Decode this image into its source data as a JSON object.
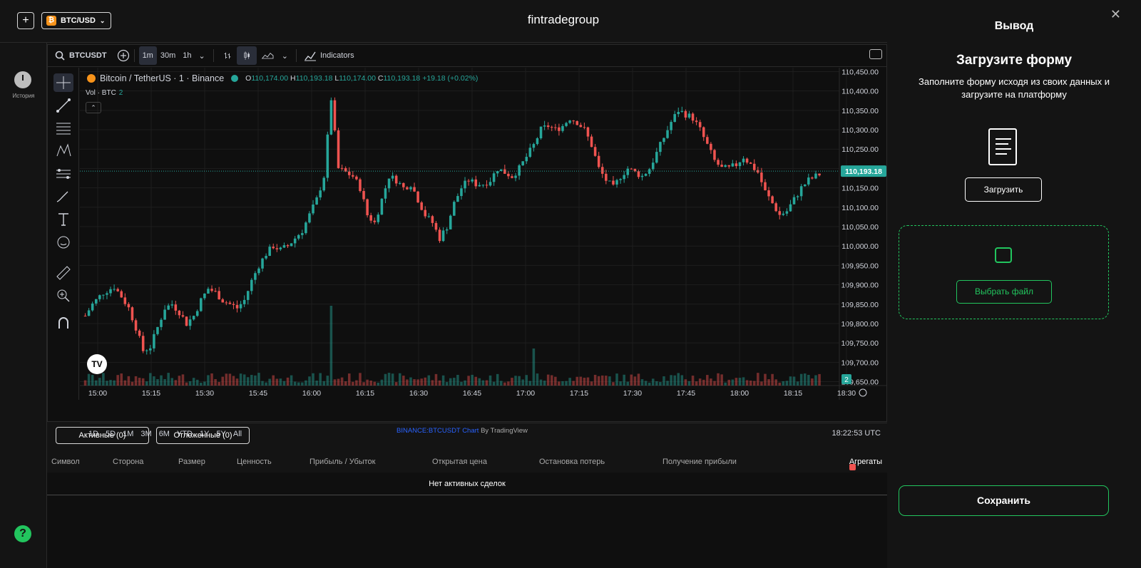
{
  "topbar": {
    "add_label": "+",
    "pair": "BTC/USD",
    "pair_icon": "₿",
    "brand": "fintradegroup"
  },
  "leftrail": {
    "history_label": "История",
    "help": "?"
  },
  "chart_toolbar": {
    "symbol": "BTCUSDT",
    "intervals": [
      "1m",
      "30m",
      "1h"
    ],
    "active_interval": "1m",
    "indicators_label": "Indicators"
  },
  "legend": {
    "title": "Bitcoin / TetherUS · 1 · Binance",
    "o": "110,174.00",
    "h": "110,193.18",
    "l": "110,174.00",
    "c": "110,193.18",
    "change": "+19.18 (+0.02%)",
    "vol_label": "Vol · BTC",
    "vol_value": "2"
  },
  "timerange": {
    "buttons": [
      "1D",
      "5D",
      "1M",
      "3M",
      "6M",
      "YTD",
      "1Y",
      "5Y",
      "All"
    ],
    "clock": "18:22:53 UTC"
  },
  "chart_data": {
    "type": "candlestick",
    "x_ticks": [
      "15:00",
      "15:15",
      "15:30",
      "15:45",
      "16:00",
      "16:15",
      "16:30",
      "16:45",
      "17:00",
      "17:15",
      "17:30",
      "17:45",
      "18:00",
      "18:15",
      "18:30"
    ],
    "y_ticks": [
      "110,450.00",
      "110,400.00",
      "110,350.00",
      "110,300.00",
      "110,250.00",
      "110,200.00",
      "110,150.00",
      "110,100.00",
      "110,050.00",
      "110,000.00",
      "109,950.00",
      "109,900.00",
      "109,850.00",
      "109,800.00",
      "109,750.00",
      "109,700.00",
      "109,650.00"
    ],
    "ylim": [
      109640,
      110460
    ],
    "last_price": "110,193.18",
    "last_price_value": 110193.18,
    "vol_badge": "2",
    "close_path": [
      [
        0,
        109820
      ],
      [
        2,
        109850
      ],
      [
        5,
        109880
      ],
      [
        8,
        109895
      ],
      [
        10,
        109870
      ],
      [
        12,
        109840
      ],
      [
        14,
        109790
      ],
      [
        16,
        109730
      ],
      [
        18,
        109740
      ],
      [
        20,
        109790
      ],
      [
        22,
        109840
      ],
      [
        24,
        109850
      ],
      [
        26,
        109830
      ],
      [
        28,
        109800
      ],
      [
        30,
        109820
      ],
      [
        32,
        109860
      ],
      [
        34,
        109890
      ],
      [
        36,
        109880
      ],
      [
        38,
        109860
      ],
      [
        40,
        109850
      ],
      [
        42,
        109840
      ],
      [
        44,
        109860
      ],
      [
        46,
        109910
      ],
      [
        48,
        109950
      ],
      [
        50,
        109980
      ],
      [
        52,
        110000
      ],
      [
        54,
        109990
      ],
      [
        56,
        110000
      ],
      [
        58,
        110020
      ],
      [
        60,
        110040
      ],
      [
        62,
        110080
      ],
      [
        64,
        110120
      ],
      [
        66,
        110180
      ],
      [
        68,
        110380
      ],
      [
        70,
        110200
      ],
      [
        72,
        110190
      ],
      [
        74,
        110180
      ],
      [
        76,
        110150
      ],
      [
        78,
        110080
      ],
      [
        80,
        110060
      ],
      [
        82,
        110120
      ],
      [
        84,
        110180
      ],
      [
        86,
        110170
      ],
      [
        88,
        110150
      ],
      [
        90,
        110160
      ],
      [
        92,
        110120
      ],
      [
        94,
        110080
      ],
      [
        96,
        110060
      ],
      [
        98,
        110020
      ],
      [
        100,
        110050
      ],
      [
        102,
        110110
      ],
      [
        104,
        110150
      ],
      [
        106,
        110170
      ],
      [
        108,
        110160
      ],
      [
        110,
        110160
      ],
      [
        112,
        110170
      ],
      [
        114,
        110200
      ],
      [
        116,
        110190
      ],
      [
        118,
        110180
      ],
      [
        120,
        110200
      ],
      [
        122,
        110230
      ],
      [
        124,
        110260
      ],
      [
        126,
        110300
      ],
      [
        128,
        110310
      ],
      [
        130,
        110300
      ],
      [
        132,
        110310
      ],
      [
        134,
        110330
      ],
      [
        136,
        110320
      ],
      [
        138,
        110300
      ],
      [
        140,
        110260
      ],
      [
        142,
        110200
      ],
      [
        144,
        110170
      ],
      [
        146,
        110150
      ],
      [
        148,
        110180
      ],
      [
        150,
        110200
      ],
      [
        152,
        110190
      ],
      [
        154,
        110180
      ],
      [
        156,
        110200
      ],
      [
        158,
        110240
      ],
      [
        160,
        110280
      ],
      [
        162,
        110320
      ],
      [
        164,
        110350
      ],
      [
        166,
        110340
      ],
      [
        168,
        110330
      ],
      [
        170,
        110300
      ],
      [
        172,
        110260
      ],
      [
        174,
        110220
      ],
      [
        176,
        110200
      ],
      [
        178,
        110200
      ],
      [
        180,
        110210
      ],
      [
        182,
        110230
      ],
      [
        184,
        110210
      ],
      [
        186,
        110190
      ],
      [
        188,
        110140
      ],
      [
        190,
        110110
      ],
      [
        192,
        110080
      ],
      [
        194,
        110090
      ],
      [
        196,
        110120
      ],
      [
        198,
        110150
      ],
      [
        200,
        110170
      ],
      [
        202,
        110180
      ],
      [
        204,
        110190
      ]
    ],
    "volume_spike_x": [
      68,
      124
    ]
  },
  "bottom": {
    "credit_link": "BINANCE:BTCUSDT Chart",
    "credit_by": " By TradingView",
    "tabs": [
      "Активные (0)",
      "Отложенные (0)"
    ],
    "columns": [
      "Символ",
      "Сторона",
      "Размер",
      "Ценность",
      "Прибыль / Убыток",
      "Открытая цена",
      "Остановка потерь",
      "Получение прибыли"
    ],
    "aggregates_label": "Агрегаты",
    "empty_message": "Нет активных сделок"
  },
  "panel": {
    "close": "✕",
    "title": "Вывод",
    "heading": "Загрузите форму",
    "subtitle": "Заполните форму исходя из своих данных и загрузите на платформу",
    "upload_label": "Загрузить",
    "pick_file_label": "Выбрать файл",
    "save_label": "Сохранить"
  },
  "colors": {
    "up": "#26a69a",
    "down": "#ef5350",
    "accent": "#22c55e"
  }
}
